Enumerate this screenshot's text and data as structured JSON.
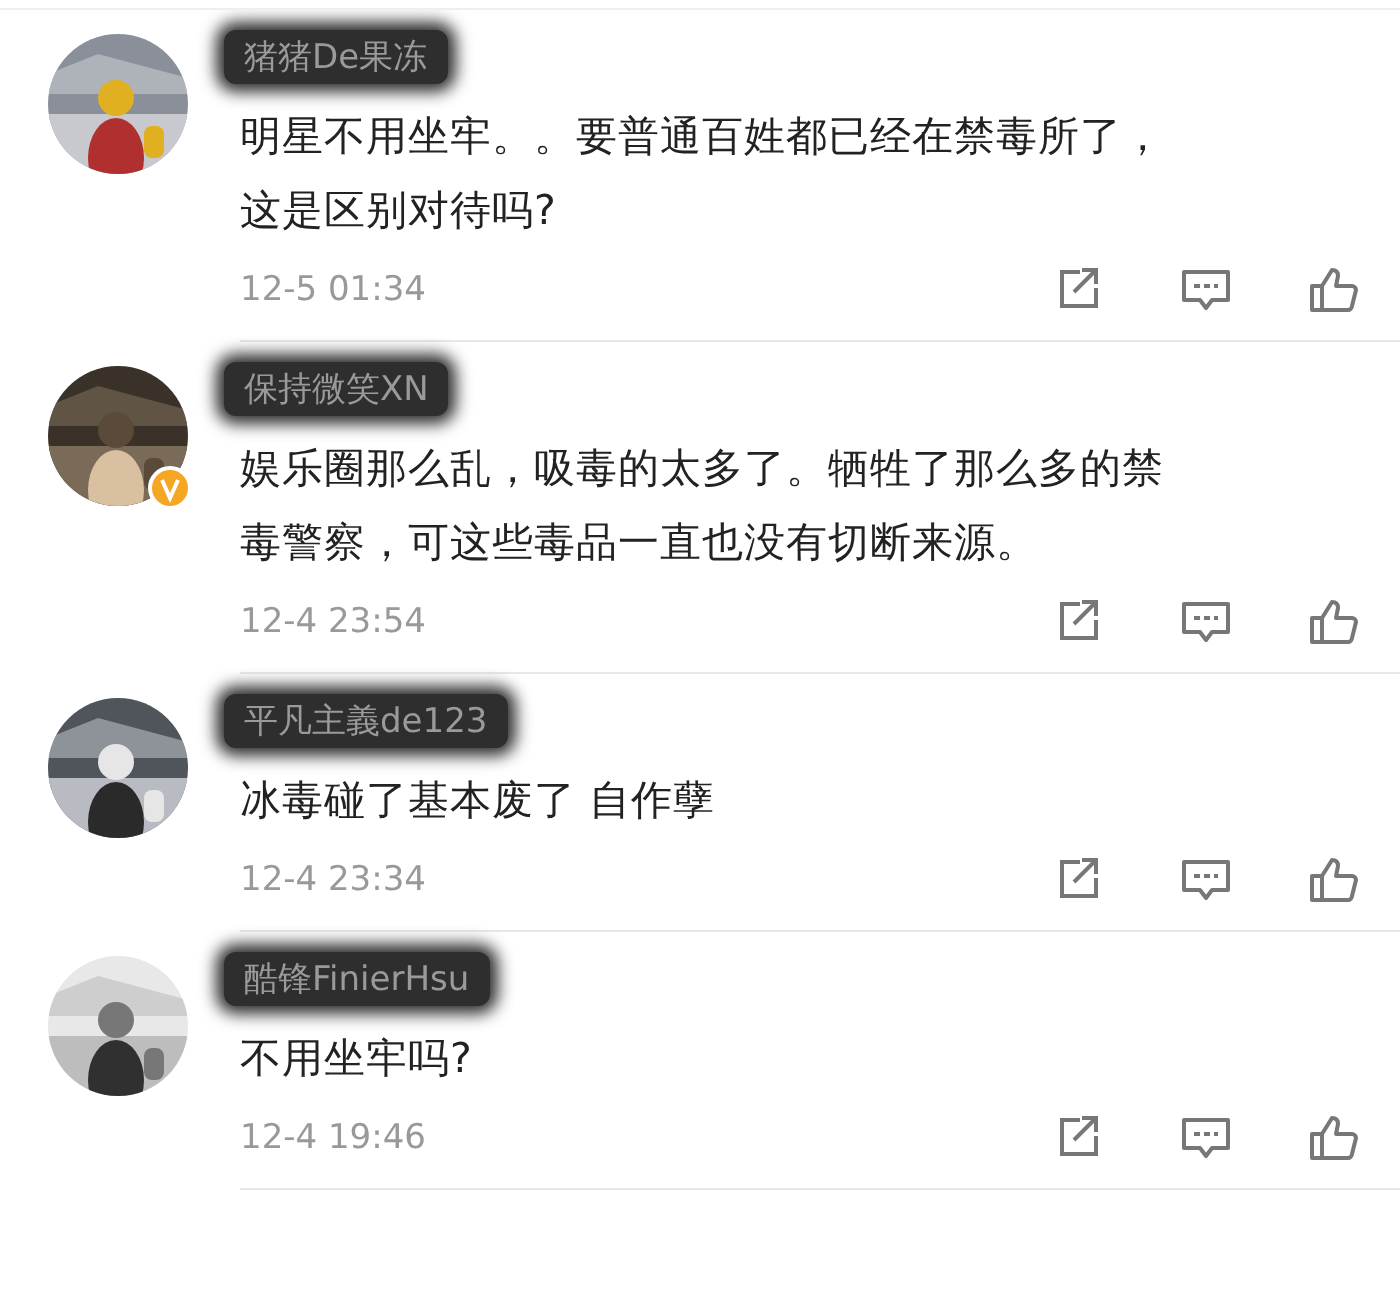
{
  "comments": [
    {
      "username": "猪猪De果冻",
      "verified": false,
      "text": "明星不用坐牢。。要普通百姓都已经在禁毒所了，这是区别对待吗?",
      "time": "12-5 01:34"
    },
    {
      "username": "保持微笑XN",
      "verified": true,
      "text": "娱乐圈那么乱，吸毒的太多了。牺牲了那么多的禁毒警察，可这些毒品一直也没有切断来源。",
      "time": "12-4 23:54"
    },
    {
      "username": "平凡主義de123",
      "verified": false,
      "text": "冰毒碰了基本废了 自作孽",
      "time": "12-4 23:34"
    },
    {
      "username": "酷锋FinierHsu",
      "verified": false,
      "text": "不用坐牢吗?",
      "time": "12-4 19:46"
    }
  ]
}
